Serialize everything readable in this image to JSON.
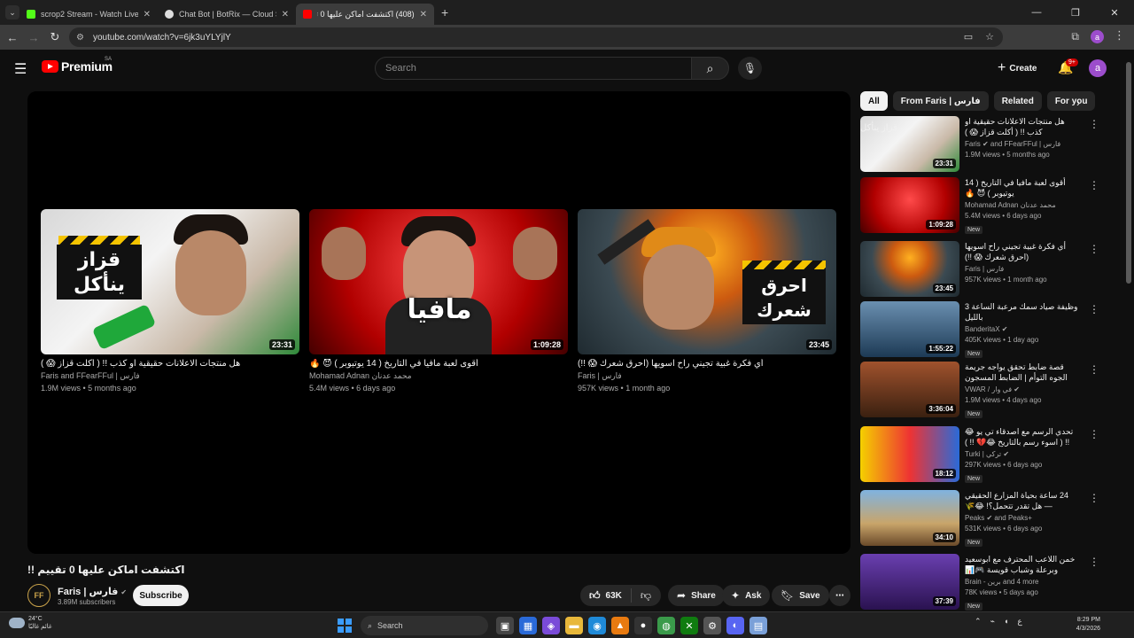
{
  "browser": {
    "tabs": [
      {
        "title": "scrop2 Stream - Watch Live on",
        "favicon_color": "#53fc18",
        "active": false
      },
      {
        "title": "Chat Bot | BotRix — Cloud Strea",
        "favicon_color": "#dddddd",
        "active": false
      },
      {
        "title": "(408) اكتشفت اماكن عليها 0 تقيي",
        "favicon_color": "#ff0000",
        "active": true
      }
    ],
    "new_tab": "+",
    "url": "youtube.com/watch?v=6jk3uYLYjlY",
    "profile_initial": "a"
  },
  "header": {
    "logo_text": "Premium",
    "country": "SA",
    "search_placeholder": "Search",
    "create_label": "Create",
    "notifications_badge": "9+",
    "avatar_initial": "a"
  },
  "end_cards": [
    {
      "title": "هل منتجات الاعلانات حقيقية او كذب !! ( أكلت قزاز 😱 )",
      "channel": "Faris and FFearFFul | فارس",
      "views": "1.9M views",
      "age": "5 months ago",
      "duration": "23:31",
      "thumb_text": "قزاز ينأكل"
    },
    {
      "title": "أقوى لعبة مافيا في التاريخ ( 14 يوتيوبر ) 😈 🔥",
      "channel": "Mohamad Adnan محمد عدنان",
      "views": "5.4M views",
      "age": "6 days ago",
      "duration": "1:09:28",
      "thumb_text": "مافيا"
    },
    {
      "title": "أي فكرة غبية تجيني راح اسويها (احرق شعرك 😱 !!)",
      "channel": "Faris | فارس",
      "views": "957K views",
      "age": "1 month ago",
      "duration": "23:45",
      "thumb_text": "احرق شعرك"
    }
  ],
  "video": {
    "title": "اكتشفت اماكن عليها 0 تقييم !!",
    "channel": "Faris | فارس",
    "subscribers": "3.89M subscribers",
    "subscribe_label": "Subscribe",
    "likes": "63K",
    "share_label": "Share",
    "ask_label": "Ask",
    "save_label": "Save"
  },
  "chips": [
    "All",
    "From Faris | فارس",
    "Related",
    "For you"
  ],
  "recommendations": [
    {
      "title": "هل منتجات الاعلانات حقيقية او كذب !! ( أكلت قزاز 😱 )",
      "channel": "Faris ✔ and FFearFFul | فارس",
      "meta": "1.9M views • 5 months ago",
      "duration": "23:31",
      "new": false
    },
    {
      "title": "أقوى لعبة مافيا في التاريخ ( 14 يوتيوبر ) 😈 🔥",
      "channel": "Mohamad Adnan محمد عدنان",
      "meta": "5.4M views • 6 days ago",
      "duration": "1:09:28",
      "new": true
    },
    {
      "title": "أي فكرة غبية تجيني راح اسويها (احرق شعرك 😱 !!)",
      "channel": "Faris | فارس",
      "meta": "957K views • 1 month ago",
      "duration": "23:45",
      "new": false
    },
    {
      "title": "وظيفة صياد سمك مرعبة الساعة 3 بالليل",
      "channel": "BanderitaX ✔",
      "meta": "405K views • 1 day ago",
      "duration": "1:55:22",
      "new": true
    },
    {
      "title": "قصة ضابط تحقق يواجه جريمة الجوه التوأم | الضابط المسجون 🚨💔",
      "channel": "VWAR / في وار ✔",
      "meta": "1.9M views • 4 days ago",
      "duration": "3:36:04",
      "new": true
    },
    {
      "title": "تحدي الرسم مع اصدقاء تي يو 😂 !! ( اسوء رسم بالتاريخ 😂💔 !! )",
      "channel": "Turki | تركي ✔",
      "meta": "297K views • 6 days ago",
      "duration": "18:12",
      "new": true
    },
    {
      "title": "24 ساعة بحياة المزارع الحقيقي — هل تقدر تتحمل؟! 😂🌾",
      "channel": "Peaks ✔ and Peaks+",
      "meta": "531K views • 6 days ago",
      "duration": "34:10",
      "new": true
    },
    {
      "title": "خمن اللاعب المحترف مع ابوسعيد وبرعلة وشباب قويسة 🎮📊",
      "channel": "Brain - برين and 4 more",
      "meta": "78K views • 5 days ago",
      "duration": "37:39",
      "new": true
    }
  ],
  "taskbar": {
    "temperature": "24°C",
    "weather_desc": "غائم غالبًا",
    "search_label": "Search",
    "time": "8:29 PM",
    "date": "4/3/2026"
  }
}
